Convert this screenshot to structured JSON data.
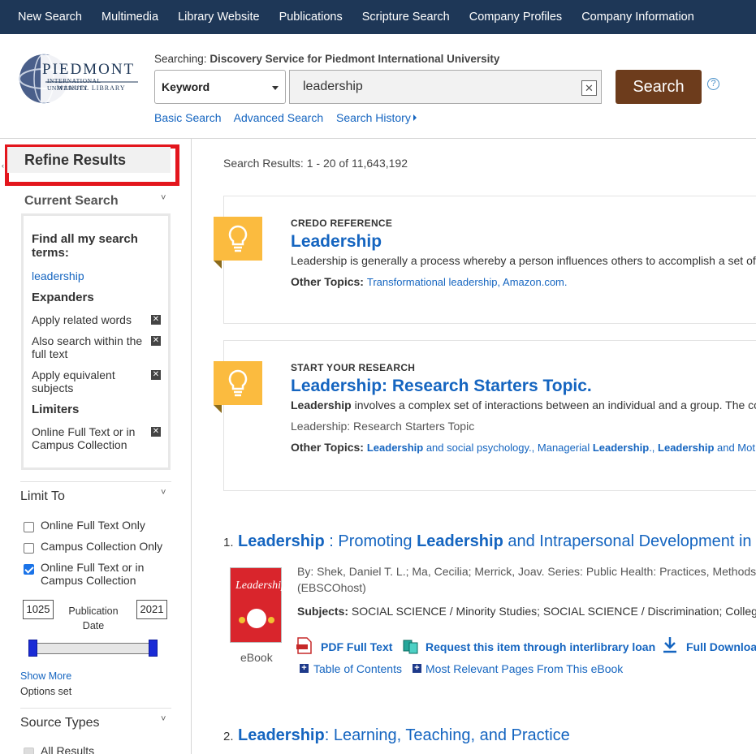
{
  "topnav": [
    "New Search",
    "Multimedia",
    "Library Website",
    "Publications",
    "Scripture Search",
    "Company Profiles",
    "Company Information"
  ],
  "logo": {
    "line1": "PIEDMONT",
    "line2": "INTERNATIONAL UNIVERSITY",
    "line3": "MANUEL LIBRARY"
  },
  "search": {
    "searching_label": "Searching:",
    "searching_target": "Discovery Service for Piedmont International University",
    "field": "Keyword",
    "query": "leadership",
    "button": "Search",
    "help": "?",
    "links": [
      "Basic Search",
      "Advanced Search",
      "Search History"
    ]
  },
  "sidebar": {
    "refine": "Refine Results",
    "current_search": "Current Search",
    "find_all": "Find all my search terms:",
    "term": "leadership",
    "expanders_title": "Expanders",
    "expanders": [
      "Apply related words",
      "Also search within the full text",
      "Apply equivalent subjects"
    ],
    "limiters_title": "Limiters",
    "limiters": [
      "Online Full Text or in Campus Collection"
    ],
    "limit_to": "Limit To",
    "limit_options": [
      {
        "label": "Online Full Text Only",
        "checked": false
      },
      {
        "label": "Campus Collection Only",
        "checked": false
      },
      {
        "label": "Online Full Text or in Campus Collection",
        "checked": true
      }
    ],
    "date_from": "1025",
    "date_to": "2021",
    "date_label": "Publication Date",
    "show_more": "Show More",
    "options_set": "Options set",
    "source_types": "Source Types",
    "all_results": "All Results"
  },
  "results": {
    "count": "Search Results: 1 - 20 of 11,643,192",
    "cards": [
      {
        "kicker": "CREDO REFERENCE",
        "title": "Leadership",
        "desc": "Leadership is generally a process whereby a person influences others to accomplish a set of",
        "other_label": "Other Topics:",
        "other": "Transformational leadership, Amazon.com."
      },
      {
        "kicker": "START YOUR RESEARCH",
        "title": "Leadership: Research Starters Topic.",
        "desc_bold": "Leadership",
        "desc": " involves a complex set of interactions between an individual and a group. The co",
        "sub": "Leadership: Research Starters Topic",
        "other_label": "Other Topics:",
        "other_parts": [
          "Leadership",
          " and social psychology., Managerial ",
          "Leadership",
          "., ",
          "Leadership",
          " and Mot"
        ]
      }
    ],
    "items": [
      {
        "num": "1.",
        "title_parts": [
          "Leadership",
          " : Promoting ",
          "Leadership",
          " and Intrapersonal Development in"
        ],
        "by": "By: Shek, Daniel T. L.; Ma, Cecilia; Merrick, Joav. Series: Public Health: Practices, Methods and",
        "source": "(EBSCOhost)",
        "subjects_label": "Subjects:",
        "subjects": "SOCIAL SCIENCE / Minority Studies; SOCIAL SCIENCE / Discrimination; College st",
        "format": "eBook",
        "book_title": "Leadership",
        "actions": [
          "PDF Full Text",
          "Request this item through interlibrary loan",
          "Full Downloa"
        ],
        "sublinks": [
          "Table of Contents",
          "Most Relevant Pages From This eBook"
        ]
      },
      {
        "num": "2.",
        "title_parts": [
          "Leadership",
          ": Learning, Teaching, and Practice"
        ]
      }
    ]
  },
  "colors": {
    "nav": "#1e3757",
    "search_button": "#6d3c1c",
    "link": "#1565c0",
    "highlight": "#e3161d",
    "bulb": "#fbbb3f"
  }
}
